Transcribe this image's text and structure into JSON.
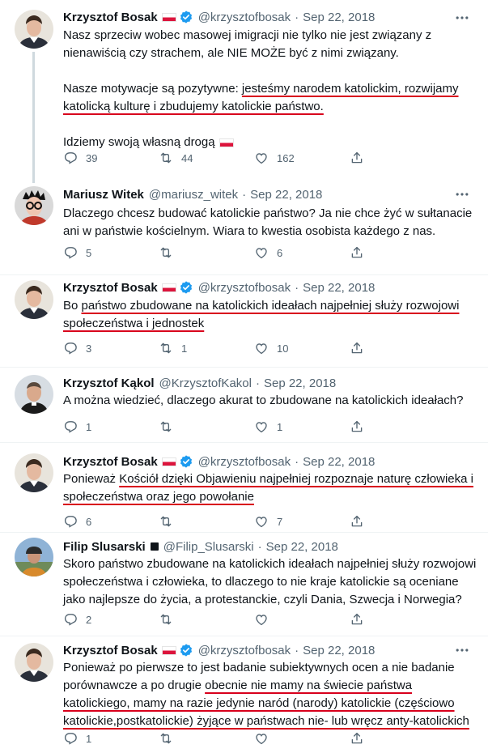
{
  "tweets": [
    {
      "name": "Krzysztof Bosak",
      "handle": "@krzysztofbosak",
      "date": "Sep 22, 2018",
      "flag": true,
      "verified": true,
      "lines": [
        "Nasz sprzeciw wobec masowej imigracji nie tylko nie jest związany z",
        "nienawiścią czy strachem, ale NIE MOŻE być z nimi związany."
      ],
      "line3a": "Nasze motywacje są pozytywne: ",
      "line3b": "jesteśmy narodem katolickim, rozwijamy",
      "line4": "katolicką kulturę i zbudujemy katolickie państwo.",
      "line5": "Idziemy swoją własną drogą",
      "replies": "39",
      "retweets": "44",
      "likes": "162"
    },
    {
      "name": "Mariusz Witek",
      "handle": "@mariusz_witek",
      "date": "Sep 22, 2018",
      "lines": [
        "Dlaczego chcesz budować katolickie państwo? Ja nie chce żyć w sułtanacie",
        "ani w państwie kościelnym. Wiara to kwestia osobista każdego z nas."
      ],
      "replies": "5",
      "retweets": "",
      "likes": "6"
    },
    {
      "name": "Krzysztof Bosak",
      "handle": "@krzysztofbosak",
      "date": "Sep 22, 2018",
      "flag": true,
      "verified": true,
      "l1a": "Bo ",
      "l1b": "państwo zbudowane na katolickich ideałach najpełniej służy rozwojowi",
      "l2": "społeczeństwa i jednostek",
      "replies": "3",
      "retweets": "1",
      "likes": "10"
    },
    {
      "name": "Krzysztof Kąkol",
      "handle": "@KrzysztofKakol",
      "date": "Sep 22, 2018",
      "lines": [
        "A można wiedzieć, dlaczego akurat to zbudowane na katolickich ideałach?"
      ],
      "replies": "1",
      "retweets": "",
      "likes": "1"
    },
    {
      "name": "Krzysztof Bosak",
      "handle": "@krzysztofbosak",
      "date": "Sep 22, 2018",
      "flag": true,
      "verified": true,
      "l1a": "Ponieważ ",
      "l1b": "Kościół dzięki Objawieniu najpełniej rozpoznaje naturę człowieka i",
      "l2": "społeczeństwa oraz jego powołanie",
      "replies": "6",
      "retweets": "",
      "likes": "7"
    },
    {
      "name": "Filip Slusarski",
      "handle": "@Filip_Slusarski",
      "date": "Sep 22, 2018",
      "lines": [
        "Skoro państwo zbudowane na katolickich ideałach najpełniej służy rozwojowi",
        "społeczeństwa i człowieka, to dlaczego to nie kraje katolickie są oceniane",
        "jako najlepsze do życia, a protestanckie, czyli Dania, Szwecja i Norwegia?"
      ],
      "replies": "2",
      "retweets": "",
      "likes": ""
    },
    {
      "name": "Krzysztof Bosak",
      "handle": "@krzysztofbosak",
      "date": "Sep 22, 2018",
      "flag": true,
      "verified": true,
      "l1": "Ponieważ po pierwsze to jest badanie subiektywnych ocen a nie badanie",
      "l2a": "porównawcze a po drugie ",
      "l2b": "obecnie nie mamy na świecie państwa",
      "l3": "katolickiego, mamy na razie jedynie naród (narody) katolickie (częściowo",
      "l4": "katolickie,postkatolickie) żyjące w państwach nie- lub wręcz anty-katolickich",
      "replies": "1",
      "retweets": "",
      "likes": ""
    }
  ],
  "colors": {
    "accent": "#1d9bf0",
    "underline": "#d8001c",
    "muted": "#536471"
  },
  "icons": [
    "reply-icon",
    "retweet-icon",
    "like-icon",
    "share-icon",
    "more-icon",
    "verified-icon",
    "polish-flag-icon"
  ]
}
